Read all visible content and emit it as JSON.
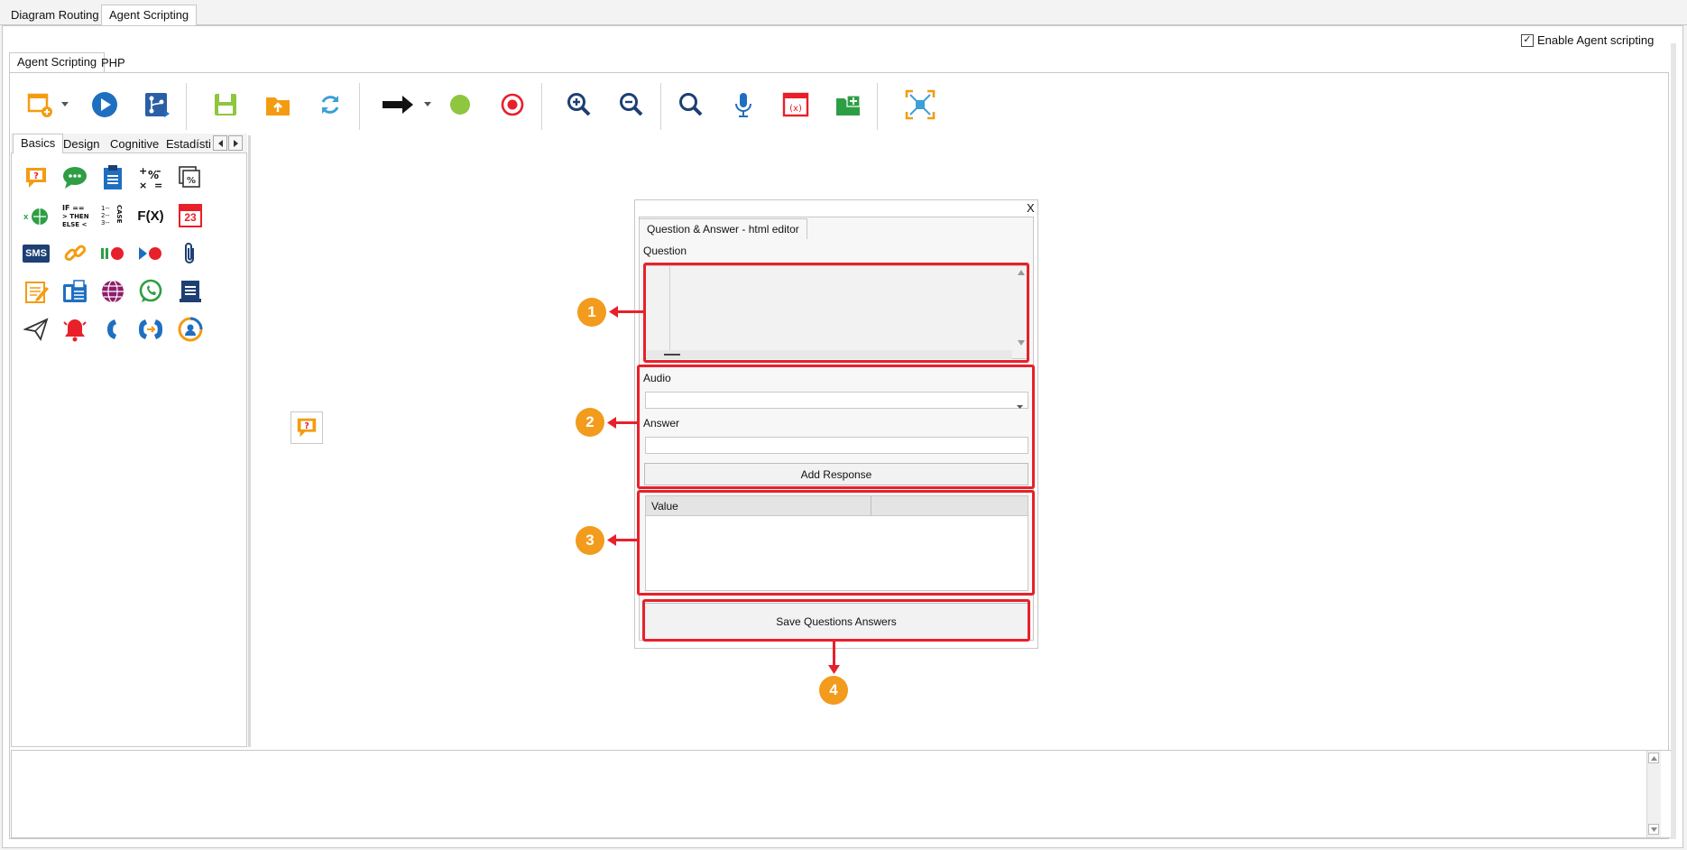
{
  "top_tabs": [
    "Diagram Routing",
    "Agent Scripting"
  ],
  "enable_checkbox": {
    "label": "Enable Agent scripting",
    "checked": true
  },
  "sub_tabs": [
    "Agent Scripting",
    "PHP"
  ],
  "toolbar_icons": [
    "new-diagram-icon",
    "dropdown-arrow-icon",
    "play-icon",
    "flow-branch-icon",
    "save-icon",
    "open-folder-icon",
    "refresh-icon",
    "arrow-right-icon",
    "dropdown-arrow-icon",
    "green-dot-icon",
    "red-target-icon",
    "zoom-in-icon",
    "zoom-out-icon",
    "search-icon",
    "microphone-icon",
    "variable-window-icon",
    "add-folder-icon",
    "fit-screen-icon"
  ],
  "palette": {
    "tabs": [
      "Basics",
      "Design",
      "Cognitive",
      "Estadísti"
    ],
    "icons": [
      "question-bubble-icon",
      "chat-icon",
      "clipboard-icon",
      "math-operators-icon",
      "percent-layers-icon",
      "globe-xml-icon",
      "if-then-else-icon",
      "case-list-icon",
      "function-icon",
      "calendar-icon",
      "sms-icon",
      "link-icon",
      "pause-record-icon",
      "play-record-icon",
      "paperclip-icon",
      "edit-note-icon",
      "fax-phone-icon",
      "web-globe-icon",
      "whatsapp-icon",
      "document-icon",
      "send-icon",
      "alarm-bell-icon",
      "phone-icon",
      "call-transfer-icon",
      "agent-timer-icon"
    ],
    "calendar_number": "23",
    "sms_text": "SMS",
    "function_text": "F(X)",
    "if_text": "IF ==\n> THEN\nELSE <",
    "case_text": "CASE"
  },
  "canvas": {
    "node_icon": "question-bubble-icon"
  },
  "dialog": {
    "close": "X",
    "tab": "Question & Answer - html editor",
    "question_label": "Question",
    "audio_label": "Audio",
    "answer_label": "Answer",
    "answer_value": "",
    "add_response": "Add Response",
    "table_headers": [
      "Value",
      ""
    ],
    "save": "Save Questions Answers"
  },
  "callouts": [
    "1",
    "2",
    "3",
    "4"
  ],
  "colors": {
    "callout": "#f29b1c",
    "highlight": "#e8202a",
    "accent_blue": "#1f6fc1",
    "accent_orange": "#f39c12",
    "accent_green": "#2e9e44"
  }
}
